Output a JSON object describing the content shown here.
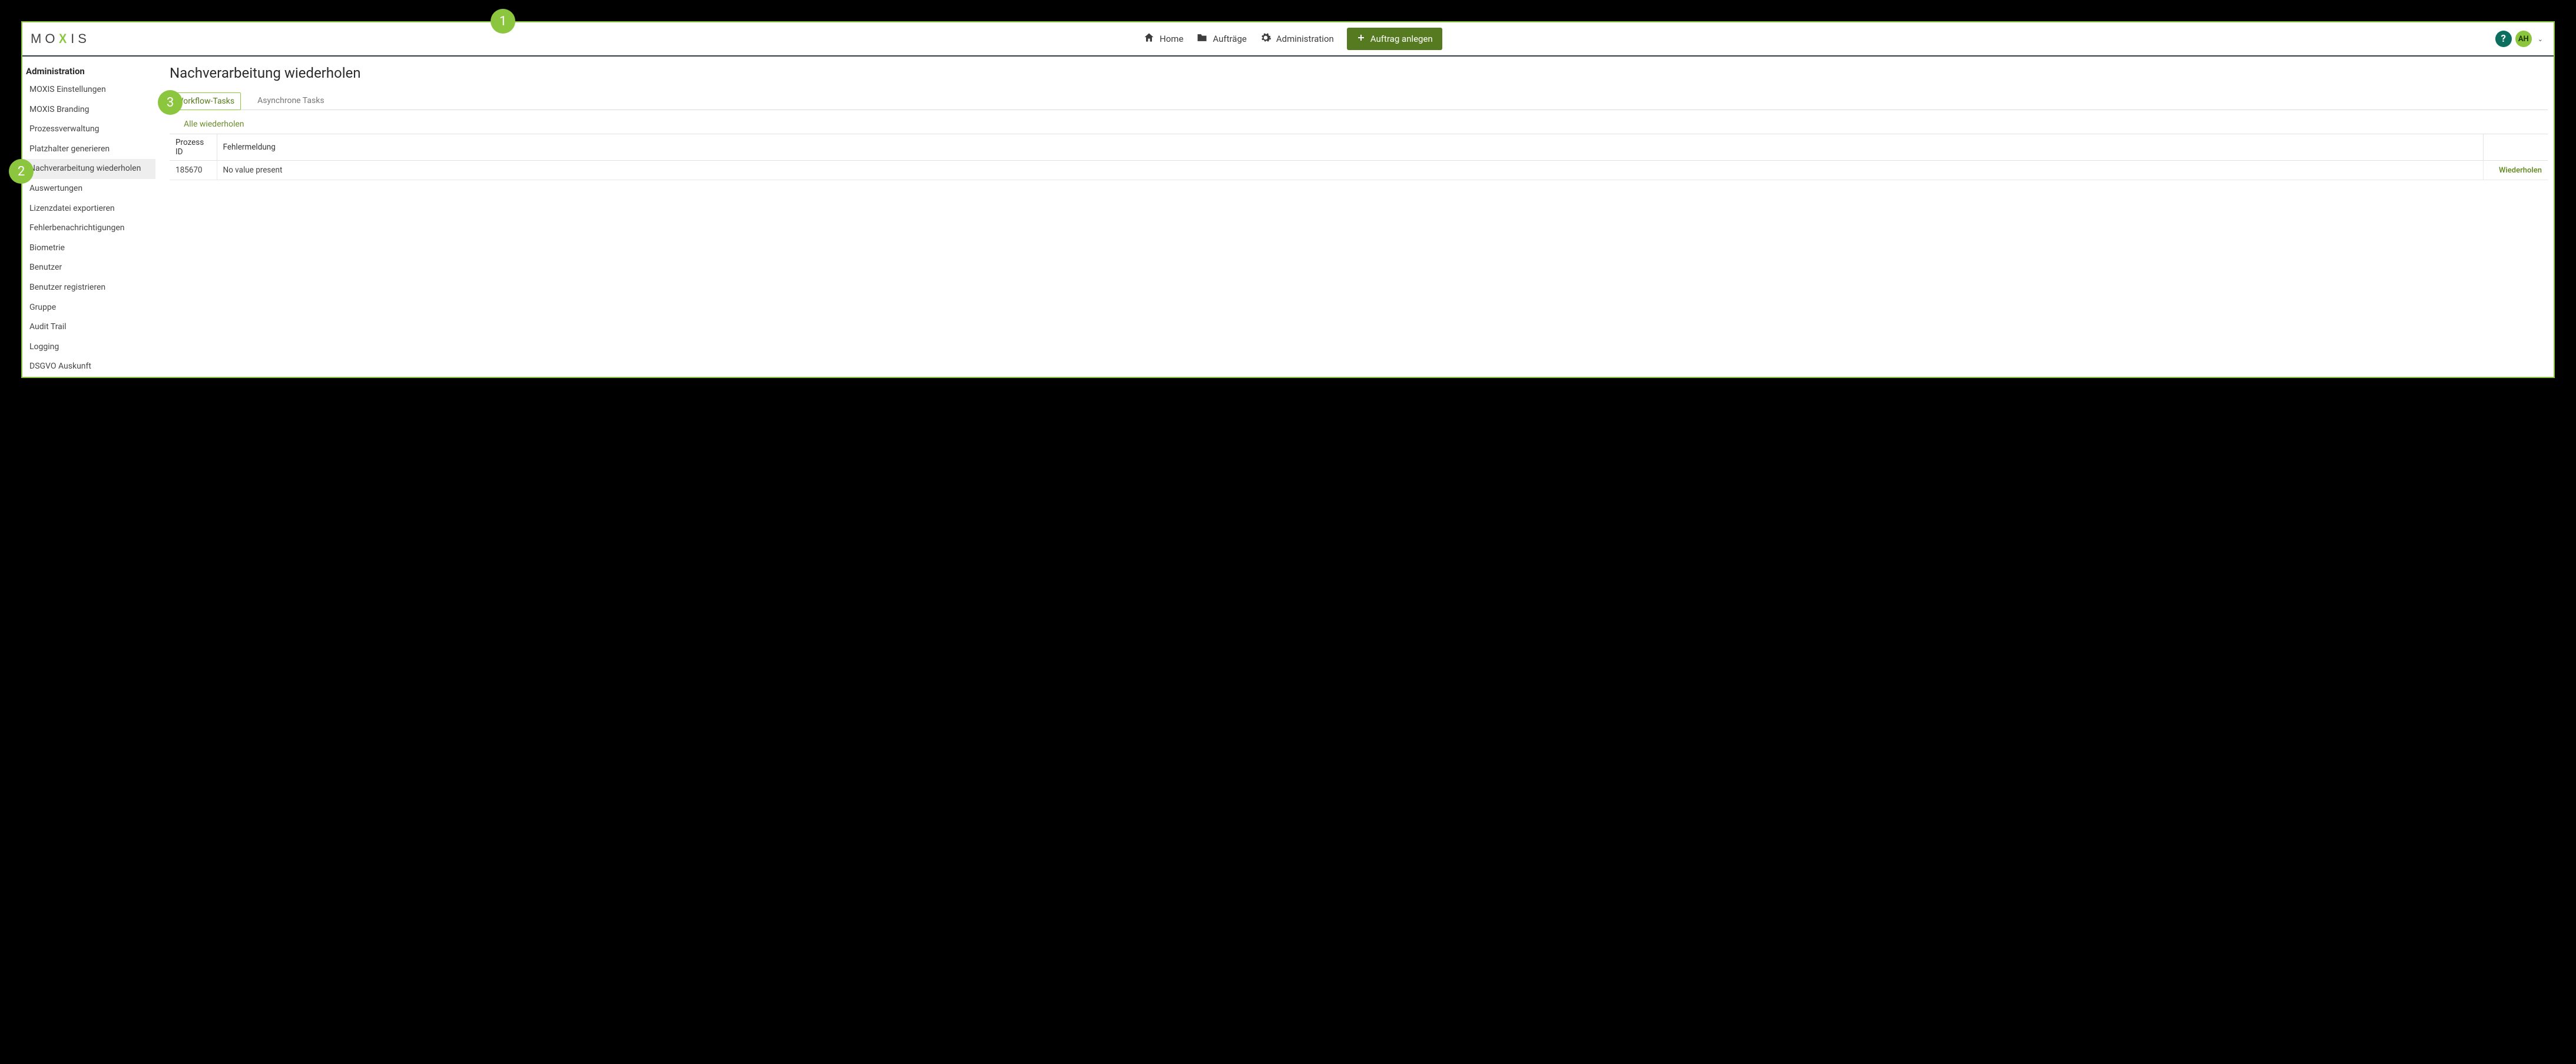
{
  "logo": {
    "letters": [
      "M",
      "O",
      "X",
      "I",
      "S"
    ]
  },
  "topnav": {
    "home": {
      "label": "Home"
    },
    "orders": {
      "label": "Aufträge"
    },
    "admin": {
      "label": "Administration"
    }
  },
  "primary_button": {
    "label": "Auftrag anlegen"
  },
  "help": {
    "glyph": "?"
  },
  "avatar": {
    "initials": "AH"
  },
  "sidebar": {
    "heading": "Administration",
    "items": [
      {
        "label": "MOXIS Einstellungen"
      },
      {
        "label": "MOXIS Branding"
      },
      {
        "label": "Prozessverwaltung"
      },
      {
        "label": "Platzhalter generieren"
      },
      {
        "label": "Nachverarbeitung wiederholen",
        "active": true
      },
      {
        "label": "Auswertungen"
      },
      {
        "label": "Lizenzdatei exportieren"
      },
      {
        "label": "Fehlerbenachrichtigungen"
      },
      {
        "label": "Biometrie"
      },
      {
        "label": "Benutzer"
      },
      {
        "label": "Benutzer registrieren"
      },
      {
        "label": "Gruppe"
      },
      {
        "label": "Audit Trail"
      },
      {
        "label": "Logging"
      },
      {
        "label": "DSGVO Auskunft"
      }
    ]
  },
  "main": {
    "title": "Nachverarbeitung wiederholen",
    "tabs": [
      {
        "label": "Workflow-Tasks",
        "active": true
      },
      {
        "label": "Asynchrone Tasks"
      }
    ],
    "repeat_all_label": "Alle wiederholen",
    "table": {
      "columns": {
        "id": "Prozess ID",
        "error": "Fehlermeldung"
      },
      "rows": [
        {
          "id": "185670",
          "error": "No value present",
          "action": "Wiederholen"
        }
      ]
    }
  },
  "callouts": {
    "c1": "1",
    "c2": "2",
    "c3": "3"
  }
}
